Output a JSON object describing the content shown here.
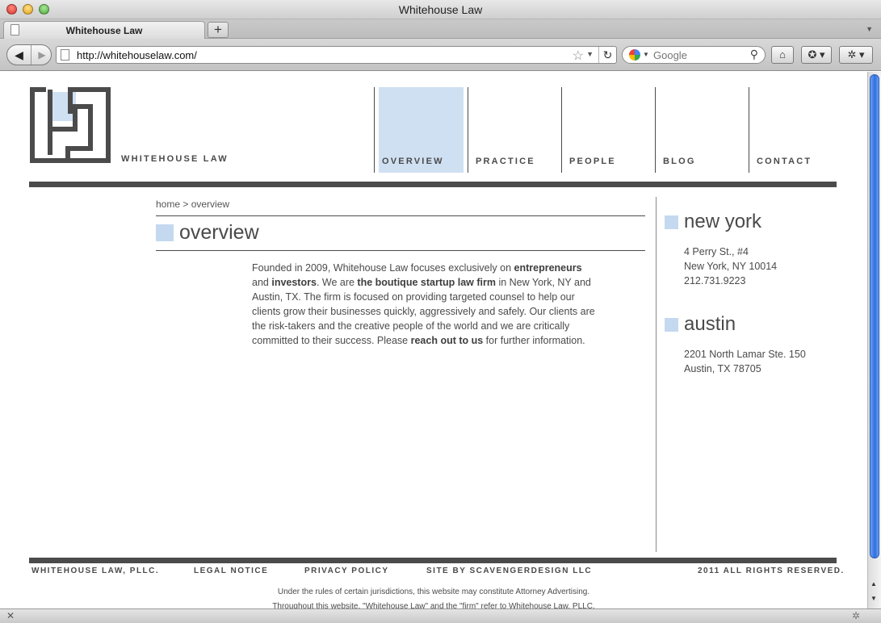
{
  "browser": {
    "window_title": "Whitehouse Law",
    "tab_title": "Whitehouse Law",
    "new_tab_label": "+",
    "url": "http://whitehouselaw.com/",
    "search_placeholder": "Google",
    "icons": [
      "back-icon",
      "forward-icon",
      "star-icon",
      "reload-icon",
      "google-icon",
      "search-icon",
      "home-icon",
      "bookmark-icon",
      "addon-icon"
    ]
  },
  "site": {
    "logo_text": "WHITEHOUSE LAW",
    "nav": [
      {
        "label": "OVERVIEW",
        "active": true
      },
      {
        "label": "PRACTICE",
        "active": false
      },
      {
        "label": "PEOPLE",
        "active": false
      },
      {
        "label": "BLOG",
        "active": false
      },
      {
        "label": "CONTACT",
        "active": false
      }
    ],
    "accent_color": "#cfe0f2",
    "dark_color": "#4b4b4b"
  },
  "main": {
    "breadcrumb": "home > overview",
    "heading": "overview",
    "body": {
      "s1": "Founded in 2009, Whitehouse Law focuses exclusively on ",
      "b1": "entrepreneurs",
      "s2": " and ",
      "b2": "investors",
      "s3": ".  We are ",
      "b3": "the boutique startup law firm",
      "s4": " in New York, NY and Austin, TX.   The firm is focused on providing targeted counsel to help our clients grow their businesses quickly, aggressively and safely. Our clients are the risk-takers and the creative people of the world and we are critically committed to their success.  Please ",
      "b4": "reach out to us",
      "s5": " for further information."
    }
  },
  "offices": [
    {
      "name": "new york",
      "lines": [
        "4 Perry St., #4",
        "New York, NY 10014",
        "212.731.9223"
      ]
    },
    {
      "name": "austin",
      "lines": [
        "2201 North Lamar Ste. 150",
        "Austin, TX 78705"
      ]
    }
  ],
  "footer": {
    "company": "WHITEHOUSE LAW, PLLC.",
    "legal": "LEGAL NOTICE",
    "privacy": "PRIVACY POLICY",
    "credit": "SITE BY SCAVENGERDESIGN LLC",
    "rights": "2011 ALL RIGHTS RESERVED.",
    "disclaimer1": "Under the rules of certain jurisdictions, this website may constitute Attorney Advertising.",
    "disclaimer2": "Throughout this website, \"Whitehouse Law\" and the \"firm\" refer to Whitehouse Law, PLLC."
  }
}
